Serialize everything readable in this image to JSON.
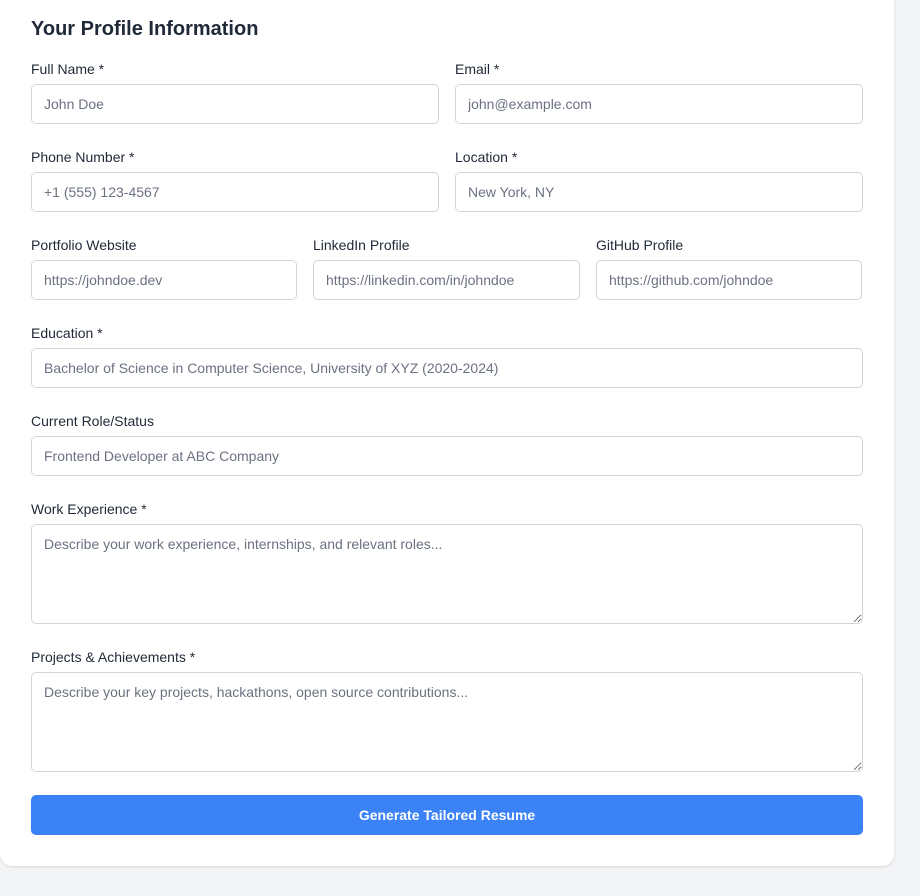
{
  "form": {
    "title": "Your Profile Information",
    "full_name": {
      "label": "Full Name *",
      "placeholder": "John Doe"
    },
    "email": {
      "label": "Email *",
      "placeholder": "john@example.com"
    },
    "phone": {
      "label": "Phone Number *",
      "placeholder": "+1 (555) 123-4567"
    },
    "location": {
      "label": "Location *",
      "placeholder": "New York, NY"
    },
    "portfolio": {
      "label": "Portfolio Website",
      "placeholder": "https://johndoe.dev"
    },
    "linkedin": {
      "label": "LinkedIn Profile",
      "placeholder": "https://linkedin.com/in/johndoe"
    },
    "github": {
      "label": "GitHub Profile",
      "placeholder": "https://github.com/johndoe"
    },
    "education": {
      "label": "Education *",
      "placeholder": "Bachelor of Science in Computer Science, University of XYZ (2020-2024)"
    },
    "current_role": {
      "label": "Current Role/Status",
      "placeholder": "Frontend Developer at ABC Company"
    },
    "work_experience": {
      "label": "Work Experience *",
      "placeholder": "Describe your work experience, internships, and relevant roles..."
    },
    "projects": {
      "label": "Projects & Achievements *",
      "placeholder": "Describe your key projects, hackathons, open source contributions..."
    },
    "submit_label": "Generate Tailored Resume"
  },
  "colors": {
    "accent": "#3b82f6",
    "border": "#d1d5db",
    "background": "#f3f4f6"
  }
}
